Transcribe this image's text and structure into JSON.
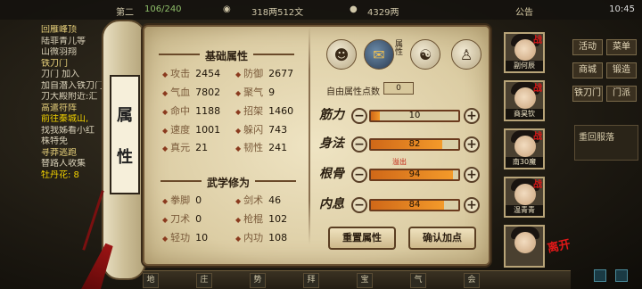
{
  "status_bar": {
    "left_fragment": "第二",
    "progress_text": "106/240",
    "money": "318两512文",
    "currency": "4329两",
    "notice": "公告",
    "time": "10:45"
  },
  "quest_log": [
    "回雁峰顶",
    "陆菲青儿等",
    "山微羽翔",
    "铁刀门",
    "刀门 加入",
    "加自潜入铁刀门",
    "刀大殿附近:汇",
    "高遣符阵",
    "前往秦城山,",
    "找我姊看小红",
    "株特免",
    "寻莽逃跑",
    "替路人收集",
    "牡丹花: 8"
  ],
  "right_menu": {
    "items": [
      "活动",
      "菜单",
      "商城",
      "锻造",
      "铁刀门",
      "门派"
    ],
    "side_text": "重回服落"
  },
  "scroll": {
    "tag_chars": [
      "属",
      "性"
    ]
  },
  "basic": {
    "title": "基础属性",
    "stats": [
      {
        "label": "攻击",
        "value": "2454"
      },
      {
        "label": "防御",
        "value": "2677"
      },
      {
        "label": "气血",
        "value": "7802"
      },
      {
        "label": "聚气",
        "value": "9"
      },
      {
        "label": "命中",
        "value": "1188"
      },
      {
        "label": "招架",
        "value": "1460"
      },
      {
        "label": "速度",
        "value": "1001"
      },
      {
        "label": "躲闪",
        "value": "743"
      },
      {
        "label": "真元",
        "value": "21"
      },
      {
        "label": "韧性",
        "value": "241"
      }
    ]
  },
  "martial": {
    "title": "武学修为",
    "stats": [
      {
        "label": "拳脚",
        "value": "0"
      },
      {
        "label": "剑术",
        "value": "46"
      },
      {
        "label": "刀术",
        "value": "0"
      },
      {
        "label": "枪棍",
        "value": "102"
      },
      {
        "label": "轻功",
        "value": "10"
      },
      {
        "label": "内功",
        "value": "108"
      }
    ]
  },
  "tabs": {
    "active_label": "属性",
    "icons": [
      "portrait-tab-icon",
      "attribute-scroll-icon",
      "taiji-icon",
      "meridian-body-icon"
    ]
  },
  "free_points": {
    "label": "自由属性点数",
    "value": "0"
  },
  "attributes": [
    {
      "label": "筋力",
      "value": "10",
      "fill": 0.1
    },
    {
      "label": "身法",
      "value": "82",
      "fill": 0.82
    },
    {
      "label": "根骨",
      "value": "94",
      "fill": 0.94,
      "overflow": "溢出"
    },
    {
      "label": "内息",
      "value": "84",
      "fill": 0.84
    }
  ],
  "buttons": {
    "reset": "重置属性",
    "confirm": "确认加点"
  },
  "party": [
    {
      "name": "副何辰",
      "battle": "战"
    },
    {
      "name": "商昊钦",
      "battle": "战"
    },
    {
      "name": "南30魔",
      "battle": "战"
    },
    {
      "name": "温青青",
      "battle": "战"
    },
    {
      "name": "",
      "battle": ""
    }
  ],
  "leave_label": "离开",
  "colors": {
    "accent_red": "#d81818",
    "bar_fill": "#f39a2a",
    "paper": "#efe4c3"
  }
}
